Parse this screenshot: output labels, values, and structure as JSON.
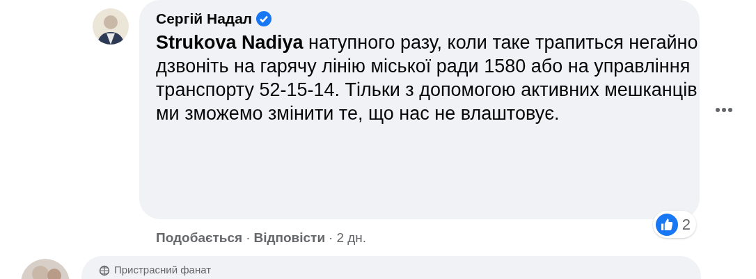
{
  "comment": {
    "author": "Сергій Надал",
    "verified": true,
    "text": "**Strukova Nadiya** натупного разу, коли таке трапиться негайно дзвоніть на гарячу лінію міської ради 1580 або на управління транспорту 52-15-14. Тільки з допомогою активних мешканців ми зможемо змінити те, що нас не влаштовує.",
    "reactions": {
      "count": "2"
    },
    "actions": [
      "Подобається",
      "Відповісти"
    ],
    "separator": "·",
    "time": "2 дн."
  },
  "next_comment": {
    "badge": "Пристрасний фанат"
  }
}
